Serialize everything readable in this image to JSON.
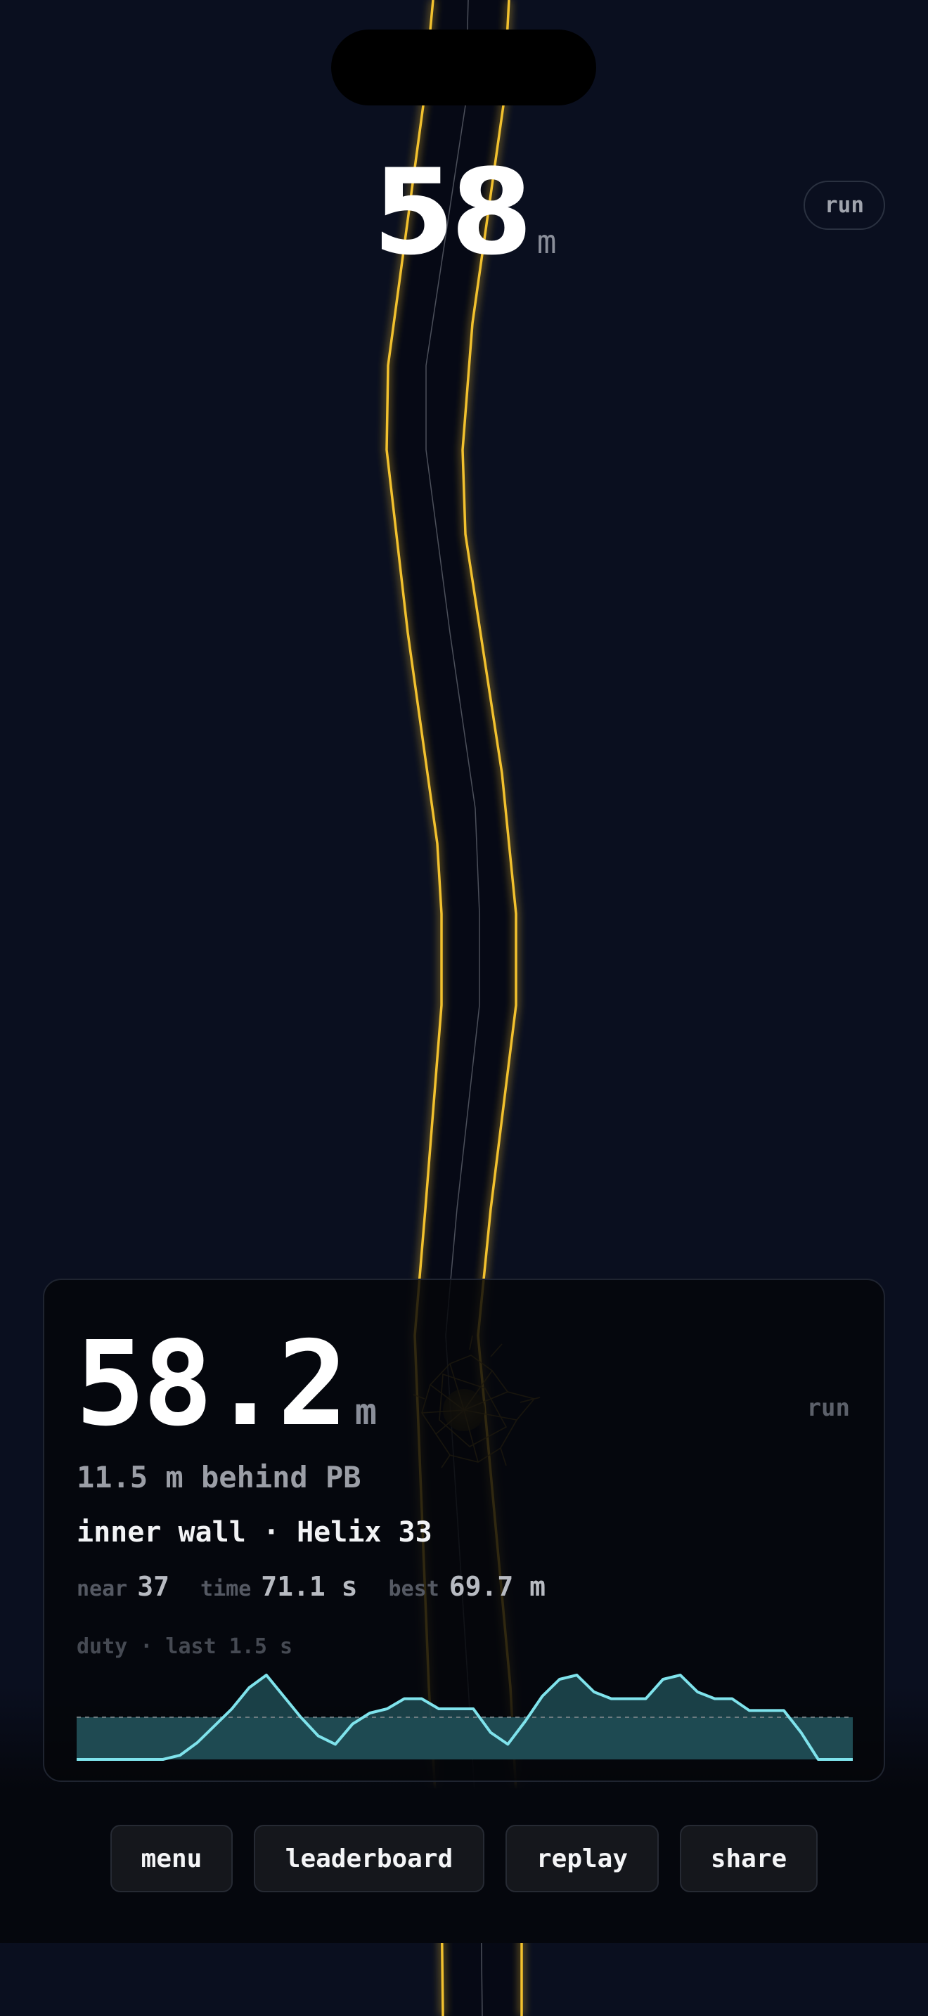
{
  "hud": {
    "distance": "58",
    "unit": "m",
    "mode": "run"
  },
  "result": {
    "distance": "58.2",
    "unit": "m",
    "mode": "run",
    "behind_pb": "11.5 m behind PB",
    "cause": "inner wall · Helix 33",
    "stats": [
      {
        "label": "near",
        "value": "37"
      },
      {
        "label": "time",
        "value": "71.1 s"
      },
      {
        "label": "best",
        "value": "69.7 m"
      }
    ],
    "duty_label": "duty · last 1.5 s",
    "duty_values": [
      0.0,
      0.0,
      0.0,
      0.0,
      0.0,
      0.0,
      0.05,
      0.2,
      0.4,
      0.6,
      0.85,
      1.0,
      0.75,
      0.5,
      0.28,
      0.18,
      0.42,
      0.55,
      0.6,
      0.72,
      0.72,
      0.6,
      0.6,
      0.6,
      0.32,
      0.18,
      0.45,
      0.75,
      0.95,
      1.0,
      0.8,
      0.72,
      0.72,
      0.72,
      0.95,
      1.0,
      0.8,
      0.72,
      0.72,
      0.58,
      0.58,
      0.58,
      0.32,
      0.0,
      0.0,
      0.0
    ],
    "duty_threshold": 0.5
  },
  "actions": {
    "menu": "menu",
    "leaderboard": "leaderboard",
    "replay": "replay",
    "share": "share"
  },
  "colors": {
    "background": "#0a0f1f",
    "track_wall": "#f2c12e",
    "duty_line": "#7fe3ec",
    "duty_fill": "#1f4a52"
  }
}
